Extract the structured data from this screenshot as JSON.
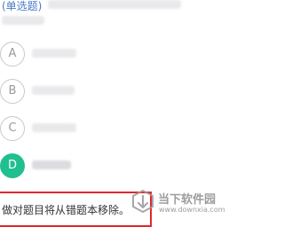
{
  "question": {
    "type_label": "(单选题)"
  },
  "options": [
    {
      "letter": "A",
      "selected": false
    },
    {
      "letter": "B",
      "selected": false
    },
    {
      "letter": "C",
      "selected": false
    },
    {
      "letter": "D",
      "selected": true
    }
  ],
  "explanation": {
    "text": "做对题目将从错题本移除。"
  },
  "watermark": {
    "title": "当下软件园",
    "url": "www.downxia.com"
  },
  "colors": {
    "accent_blue": "#4a7ac7",
    "selected_green": "#20bf8f",
    "highlight_red": "#e0282a"
  }
}
